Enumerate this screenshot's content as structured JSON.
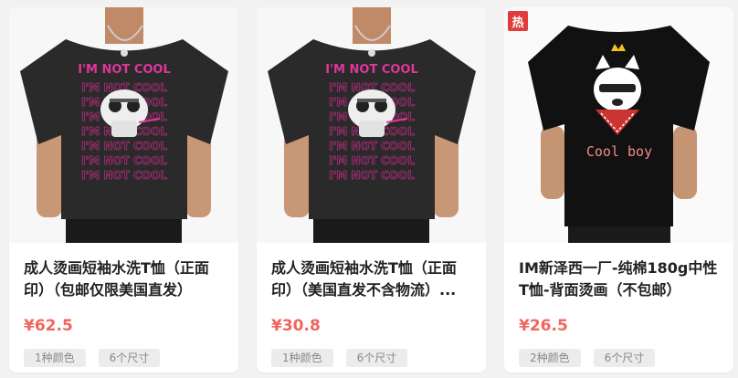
{
  "products": [
    {
      "title": "成人烫画短袖水洗T恤（正面印）（包邮仅限美国直发）",
      "price": "¥62.5",
      "tags": [
        "1种颜色",
        "6个尺寸"
      ],
      "print_text": "I'M NOT COOL",
      "print_color": "#e0369b",
      "shirt_color": "#2a2a2a"
    },
    {
      "title": "成人烫画短袖水洗T恤（正面印）（美国直发不含物流）...",
      "price": "¥30.8",
      "tags": [
        "1种颜色",
        "6个尺寸"
      ],
      "print_text": "I'M NOT COOL",
      "print_color": "#e0369b",
      "shirt_color": "#2a2a2a"
    },
    {
      "title": "IM新泽西一厂-纯棉180g中性T恤-背面烫画（不包邮）",
      "price": "¥26.5",
      "tags": [
        "2种颜色",
        "6个尺寸"
      ],
      "badge": "热",
      "print_text": "Cool boy",
      "shirt_color": "#111111"
    }
  ],
  "colors": {
    "price": "#f0655d",
    "badge": "#e23b3b"
  }
}
